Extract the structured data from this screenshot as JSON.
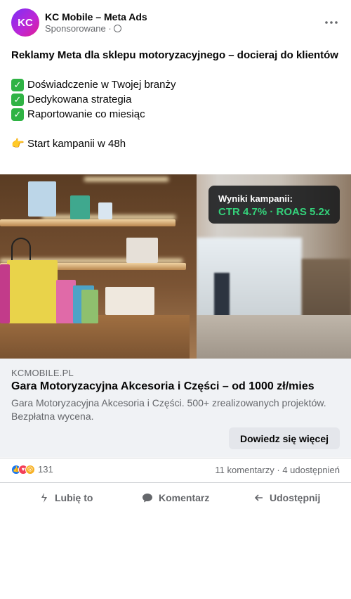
{
  "post": {
    "avatar_initials": "KC",
    "page_name": "KC Mobile – Meta Ads",
    "sponsored": "Sponsorowane ·",
    "more_icon": "more-horizontal-icon"
  },
  "ad": {
    "title": "Reklamy Meta dla sklepu motoryzacyjnego – docieraj do klientów",
    "bullets": [
      "Doświadczenie w Twojej branży",
      "Dedykowana strategia",
      "Raportowanie co miesiąc"
    ],
    "cta_line": "Start kampanii w 48h"
  },
  "media_overlay": {
    "label": "Wyniki kampanii:",
    "value": "CTR 4.7% · ROAS 5.2x"
  },
  "link_card": {
    "domain": "KCMOBILE.PL",
    "title": "Gara Motoryzacyjna Akcesoria i Części – od 1000 zł/mies",
    "description": "Gara Motoryzacyjna Akcesoria i Części. 500+ zrealizowanych projektów. Bezpłatna wycena.",
    "cta": "Dowiedz się więcej"
  },
  "engagement": {
    "reaction_count": "131",
    "comments": "11 komentarzy",
    "shares": "4 udostępnień",
    "separator": "·"
  },
  "actions": {
    "like": "Lubię to",
    "comment": "Komentarz",
    "share": "Udostępnij"
  },
  "colors": {
    "stat_green": "#34d17a",
    "check_green": "#2fb344",
    "like_blue": "#1877f2",
    "love_red": "#f33e58",
    "haha_yellow": "#f7b125"
  }
}
